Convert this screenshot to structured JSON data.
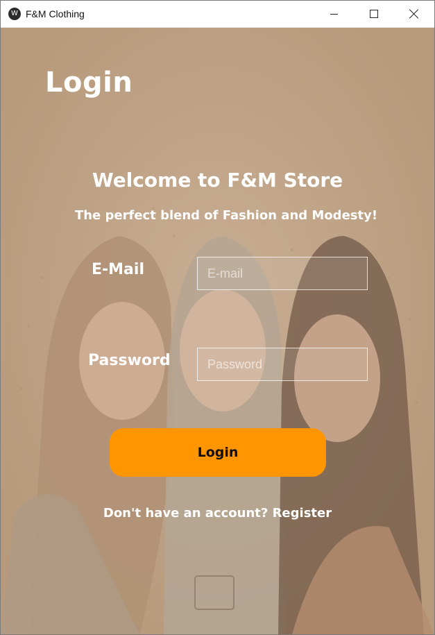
{
  "window": {
    "title": "F&M Clothing",
    "icon": "app-logo-icon"
  },
  "page": {
    "heading": "Login",
    "welcome": "Welcome to F&M Store",
    "tagline": "The perfect blend of Fashion and Modesty!"
  },
  "form": {
    "email_label": "E-Mail",
    "email_placeholder": "E-mail",
    "email_value": "",
    "password_label": "Password",
    "password_placeholder": "Password",
    "password_value": "",
    "login_label": "Login",
    "register_text": "Don't have an account? Register"
  },
  "colors": {
    "background": "#b89d82",
    "accent": "#ff9500",
    "text": "#ffffff"
  }
}
